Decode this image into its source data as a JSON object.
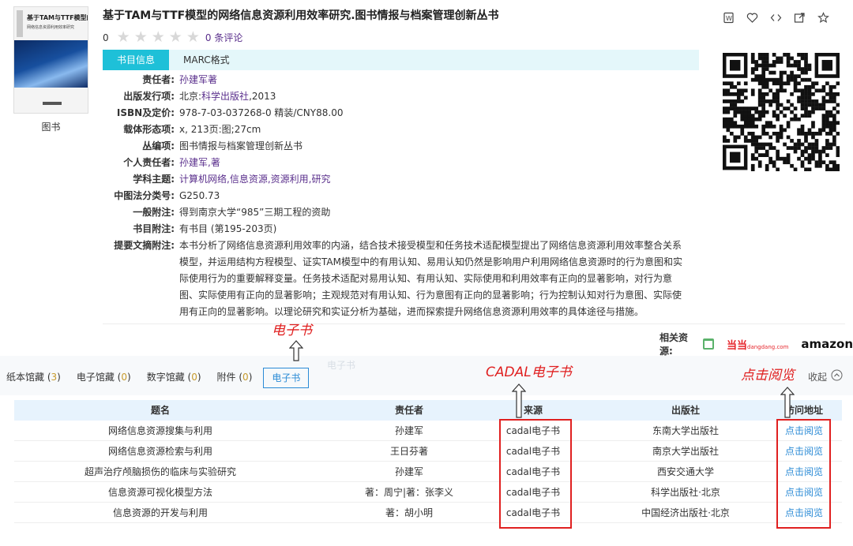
{
  "book": {
    "cover_title": "基于TAM与TTF模型的",
    "cover_subtitle": "网络信息资源利用效率研究",
    "type_label": "图书",
    "title": "基于TAM与TTF模型的网络信息资源利用效率研究.图书情报与档案管理创新丛书",
    "rating_score": "0",
    "stars_filled": 0,
    "stars_total": 5,
    "reviews": "0 条评论"
  },
  "tabs": {
    "info": "书目信息",
    "marc": "MARC格式"
  },
  "fields": [
    {
      "label": "责任者:",
      "value": "孙建军著",
      "link": true
    },
    {
      "label": "出版发行项:",
      "prefix": "北京:",
      "link_part": "科学出版社",
      "suffix": ",2013"
    },
    {
      "label": "ISBN及定价:",
      "value": "978-7-03-037268-0 精装/CNY88.00",
      "link": false
    },
    {
      "label": "载体形态项:",
      "value": "x, 213页:图;27cm",
      "link": false
    },
    {
      "label": "丛编项:",
      "value": "图书情报与档案管理创新丛书",
      "link": false
    },
    {
      "label": "个人责任者:",
      "value": "孙建军,著",
      "link": true
    },
    {
      "label": "学科主题:",
      "value": "计算机网络,信息资源,资源利用,研究",
      "link": true
    },
    {
      "label": "中图法分类号:",
      "value": "G250.73",
      "link": false
    },
    {
      "label": "一般附注:",
      "value": "得到南京大学“985”三期工程的资助",
      "link": false
    },
    {
      "label": "书目附注:",
      "value": "有书目 (第195-203页)",
      "link": false
    },
    {
      "label": "提要文摘附注:",
      "value": "本书分析了网络信息资源利用效率的内涵，结合技术接受模型和任务技术适配模型提出了网络信息资源利用效率整合关系模型，并运用结构方程模型、证实TAM模型中的有用认知、易用认知仍然是影响用户利用网络信息资源时的行为意图和实际使用行为的重要解释变量。任务技术适配对易用认知、有用认知、实际使用和利用效率有正向的显著影响，对行为意图、实际使用有正向的显著影响；主观规范对有用认知、行为意图有正向的显著影响；行为控制认知对行为意图、实际使用有正向的显著影响。以理论研究和实证分析为基础，进而探索提升网络信息资源利用效率的具体途径与措施。",
      "abstract": true
    }
  ],
  "related": {
    "label": "相关资源:",
    "dangdang": "当当",
    "dangdang_sub": "dangdang.com",
    "amazon": "amazon"
  },
  "annotations": {
    "ebook": "电子书",
    "cadal": "CADAL电子书",
    "read": "点击阅览",
    "ghost": "电子书"
  },
  "holdings": {
    "tabs": [
      {
        "label": "纸本馆藏",
        "count": "3"
      },
      {
        "label": "电子馆藏",
        "count": "0"
      },
      {
        "label": "数字馆藏",
        "count": "0"
      },
      {
        "label": "附件",
        "count": "0"
      }
    ],
    "active_tab": "电子书",
    "collapse": "收起"
  },
  "table": {
    "headers": [
      "题名",
      "责任者",
      "来源",
      "出版社",
      "访问地址"
    ],
    "rows": [
      [
        "网络信息资源搜集与利用",
        "孙建军",
        "cadal电子书",
        "东南大学出版社",
        "点击阅览"
      ],
      [
        "网络信息资源检索与利用",
        "王日芬著",
        "cadal电子书",
        "南京大学出版社",
        "点击阅览"
      ],
      [
        "超声治疗颅脑损伤的临床与实验研究",
        "孙建军",
        "cadal电子书",
        "西安交通大学",
        "点击阅览"
      ],
      [
        "信息资源可视化模型方法",
        "著：周宁|著：张李义",
        "cadal电子书",
        "科学出版社·北京",
        "点击阅览"
      ],
      [
        "信息资源的开发与利用",
        "著：胡小明",
        "cadal电子书",
        "中国经济出版社·北京",
        "点击阅览"
      ]
    ]
  },
  "colors": {
    "accent": "#1ec0d8",
    "link_purple": "#5a2f8c",
    "link_blue": "#2b8bd6",
    "annotation_red": "#e02020"
  }
}
